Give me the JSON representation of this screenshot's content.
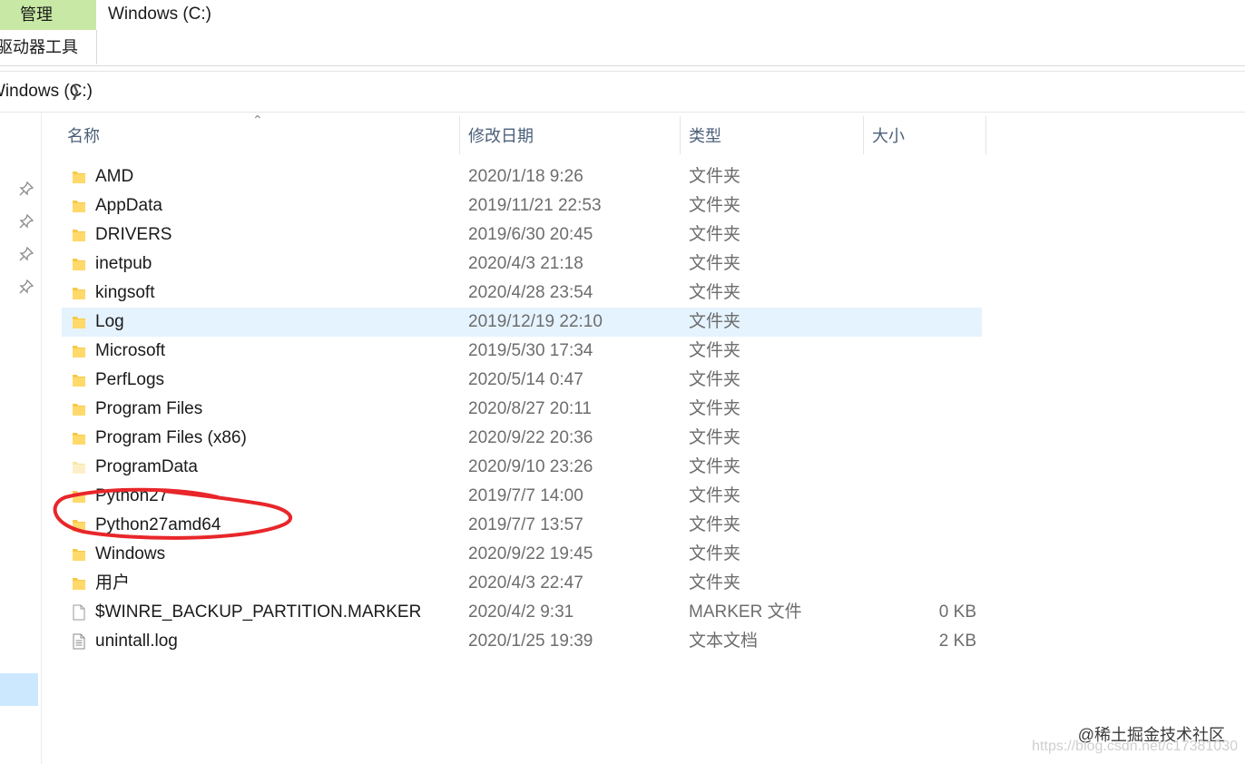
{
  "ribbon": {
    "manage_tab": "管理",
    "drive_tools_tab": "驱动器工具",
    "window_title": "Windows (C:)"
  },
  "address": {
    "crumb": "Windows (C:)"
  },
  "columns": {
    "name": "名称",
    "date": "修改日期",
    "type": "类型",
    "size": "大小"
  },
  "files": [
    {
      "name": "AMD",
      "date": "2020/1/18 9:26",
      "type": "文件夹",
      "size": "",
      "icon": "folder-icon"
    },
    {
      "name": "AppData",
      "date": "2019/11/21 22:53",
      "type": "文件夹",
      "size": "",
      "icon": "folder-icon"
    },
    {
      "name": "DRIVERS",
      "date": "2019/6/30 20:45",
      "type": "文件夹",
      "size": "",
      "icon": "folder-icon"
    },
    {
      "name": "inetpub",
      "date": "2020/4/3 21:18",
      "type": "文件夹",
      "size": "",
      "icon": "folder-icon"
    },
    {
      "name": "kingsoft",
      "date": "2020/4/28 23:54",
      "type": "文件夹",
      "size": "",
      "icon": "folder-icon"
    },
    {
      "name": "Log",
      "date": "2019/12/19 22:10",
      "type": "文件夹",
      "size": "",
      "icon": "folder-icon"
    },
    {
      "name": "Microsoft",
      "date": "2019/5/30 17:34",
      "type": "文件夹",
      "size": "",
      "icon": "folder-icon"
    },
    {
      "name": "PerfLogs",
      "date": "2020/5/14 0:47",
      "type": "文件夹",
      "size": "",
      "icon": "folder-icon"
    },
    {
      "name": "Program Files",
      "date": "2020/8/27 20:11",
      "type": "文件夹",
      "size": "",
      "icon": "folder-icon"
    },
    {
      "name": "Program Files (x86)",
      "date": "2020/9/22 20:36",
      "type": "文件夹",
      "size": "",
      "icon": "folder-icon"
    },
    {
      "name": "ProgramData",
      "date": "2020/9/10 23:26",
      "type": "文件夹",
      "size": "",
      "icon": "hidden-folder-icon"
    },
    {
      "name": "Python27",
      "date": "2019/7/7 14:00",
      "type": "文件夹",
      "size": "",
      "icon": "folder-icon"
    },
    {
      "name": "Python27amd64",
      "date": "2019/7/7 13:57",
      "type": "文件夹",
      "size": "",
      "icon": "folder-icon"
    },
    {
      "name": "Windows",
      "date": "2020/9/22 19:45",
      "type": "文件夹",
      "size": "",
      "icon": "folder-icon"
    },
    {
      "name": "用户",
      "date": "2020/4/3 22:47",
      "type": "文件夹",
      "size": "",
      "icon": "folder-icon"
    },
    {
      "name": "$WINRE_BACKUP_PARTITION.MARKER",
      "date": "2020/4/2 9:31",
      "type": "MARKER 文件",
      "size": "0 KB",
      "icon": "blank-file-icon"
    },
    {
      "name": "unintall.log",
      "date": "2020/1/25 19:39",
      "type": "文本文档",
      "size": "2 KB",
      "icon": "text-file-icon"
    }
  ],
  "highlighted_row_index": 5,
  "watermark": "@稀土掘金技术社区",
  "watermark_url": "https://blog.csdn.net/c17381030",
  "colors": {
    "folder": "#f7c948",
    "manage_tab_bg": "#c8e9a5",
    "row_highlight": "#e5f3ff",
    "annotation": "#e8262a"
  }
}
